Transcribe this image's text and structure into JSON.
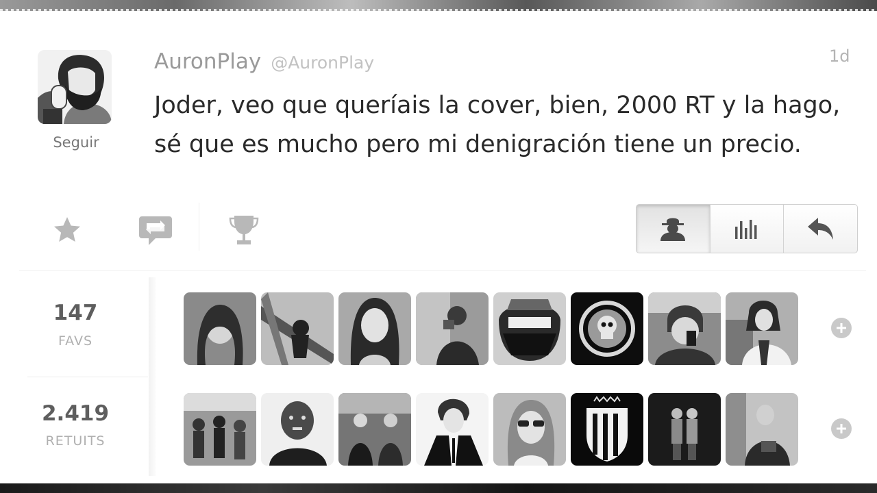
{
  "tweet": {
    "author_name": "AuronPlay",
    "author_handle": "@AuronPlay",
    "timestamp": "1d",
    "text": "Joder, veo que queríais la cover, bien, 2000 RT y la hago, sé que es mucho pero mi denigración tiene un precio.",
    "follow_label": "Seguir"
  },
  "actions": {
    "icons": [
      "star-icon",
      "retweet-icon",
      "trophy-icon"
    ]
  },
  "view_buttons": {
    "icons": [
      "person-icon",
      "bar-chart-icon",
      "reply-icon"
    ],
    "active_index": 0
  },
  "stats": {
    "favs": {
      "count": "147",
      "label": "FAVS"
    },
    "retweets": {
      "count": "2.419",
      "label": "RETUITS"
    }
  },
  "colors": {
    "background": "#ffffff",
    "tweet_text": "#2a2a2a",
    "author_name": "#9a9a9a",
    "handle": "#c2c2c2",
    "icon_gray": "#b7b7b7"
  }
}
